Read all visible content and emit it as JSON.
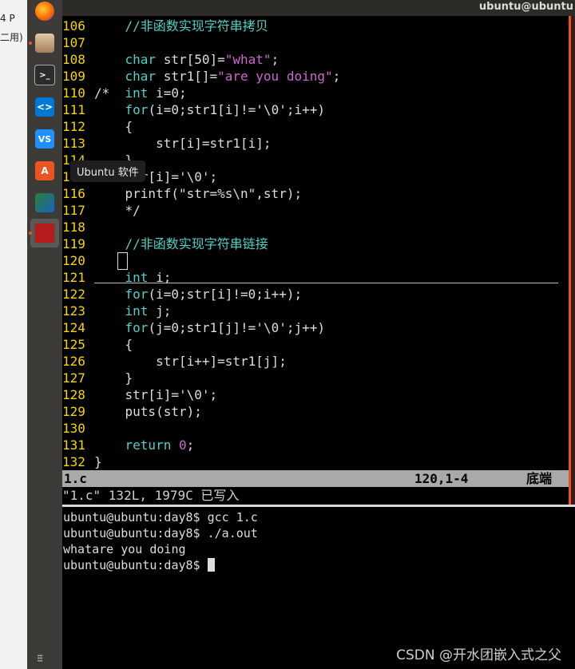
{
  "left_window": {
    "fragment1": "4 P",
    "fragment2": "二用)"
  },
  "dock": {
    "items": [
      {
        "name": "firefox-icon",
        "label": "Firefox"
      },
      {
        "name": "files-icon",
        "label": ""
      },
      {
        "name": "terminal-icon",
        "label": ""
      },
      {
        "name": "vscode-icon",
        "label": ""
      },
      {
        "name": "vscode-alt-icon",
        "label": "VS"
      },
      {
        "name": "ubuntu-software-icon",
        "label": "A"
      },
      {
        "name": "network-icon",
        "label": ""
      },
      {
        "name": "red-app-icon",
        "label": ""
      }
    ],
    "tooltip": "Ubuntu 软件",
    "apps_grid": "⁝⁝⁝"
  },
  "topbar": {
    "title": "ubuntu@ubuntu"
  },
  "vim": {
    "lines": [
      {
        "n": "106",
        "prefix": "    ",
        "html_class": "cm",
        "text": "//非函数实现字符串拷贝"
      },
      {
        "n": "107",
        "prefix": "",
        "html_class": "code",
        "text": ""
      },
      {
        "n": "108",
        "prefix": "    ",
        "segments": [
          {
            "c": "kw",
            "t": "char"
          },
          {
            "c": "code",
            "t": " str[50]="
          },
          {
            "c": "str",
            "t": "\"what\""
          },
          {
            "c": "code",
            "t": ";"
          }
        ]
      },
      {
        "n": "109",
        "prefix": "    ",
        "segments": [
          {
            "c": "kw",
            "t": "char"
          },
          {
            "c": "code",
            "t": " str1[]="
          },
          {
            "c": "str",
            "t": "\"are you doing\""
          },
          {
            "c": "code",
            "t": ";"
          }
        ]
      },
      {
        "n": "110",
        "prefix": "/*  ",
        "segments": [
          {
            "c": "kw",
            "t": "int"
          },
          {
            "c": "code",
            "t": " i=0;"
          }
        ]
      },
      {
        "n": "111",
        "prefix": "    ",
        "segments": [
          {
            "c": "kw",
            "t": "for"
          },
          {
            "c": "code",
            "t": "(i=0;str1[i]!='\\0';i++)"
          }
        ]
      },
      {
        "n": "112",
        "prefix": "    ",
        "segments": [
          {
            "c": "code",
            "t": "{"
          }
        ]
      },
      {
        "n": "113",
        "prefix": "        ",
        "segments": [
          {
            "c": "code",
            "t": "str[i]=str1[i];"
          }
        ]
      },
      {
        "n": "114",
        "prefix": "    ",
        "segments": [
          {
            "c": "code",
            "t": "}"
          }
        ]
      },
      {
        "n": "115",
        "prefix": "    ",
        "segments": [
          {
            "c": "code",
            "t": "str[i]='\\0';"
          }
        ]
      },
      {
        "n": "116",
        "prefix": "    ",
        "segments": [
          {
            "c": "code",
            "t": "printf(\"str=%s\\n\",str);"
          }
        ]
      },
      {
        "n": "117",
        "prefix": "    ",
        "segments": [
          {
            "c": "code",
            "t": "*/"
          }
        ]
      },
      {
        "n": "118",
        "prefix": "",
        "segments": []
      },
      {
        "n": "119",
        "prefix": "    ",
        "segments": [
          {
            "c": "cm",
            "t": "//非函数实现字符串链接"
          }
        ]
      },
      {
        "n": "120",
        "prefix": "",
        "segments": []
      },
      {
        "n": "121",
        "prefix": "    ",
        "segments": [
          {
            "c": "kw",
            "t": "int"
          },
          {
            "c": "code",
            "t": " i;"
          }
        ]
      },
      {
        "n": "122",
        "prefix": "    ",
        "segments": [
          {
            "c": "kw",
            "t": "for"
          },
          {
            "c": "code",
            "t": "(i=0;str[i]!=0;i++);"
          }
        ]
      },
      {
        "n": "123",
        "prefix": "    ",
        "segments": [
          {
            "c": "kw",
            "t": "int"
          },
          {
            "c": "code",
            "t": " j;"
          }
        ]
      },
      {
        "n": "124",
        "prefix": "    ",
        "segments": [
          {
            "c": "kw",
            "t": "for"
          },
          {
            "c": "code",
            "t": "(j=0;str1[j]!='\\0';j++)"
          }
        ]
      },
      {
        "n": "125",
        "prefix": "    ",
        "segments": [
          {
            "c": "code",
            "t": "{"
          }
        ]
      },
      {
        "n": "126",
        "prefix": "        ",
        "segments": [
          {
            "c": "code",
            "t": "str[i++]=str1[j];"
          }
        ]
      },
      {
        "n": "127",
        "prefix": "    ",
        "segments": [
          {
            "c": "code",
            "t": "}"
          }
        ]
      },
      {
        "n": "128",
        "prefix": "    ",
        "segments": [
          {
            "c": "code",
            "t": "str[i]='\\0';"
          }
        ]
      },
      {
        "n": "129",
        "prefix": "    ",
        "segments": [
          {
            "c": "code",
            "t": "puts(str);"
          }
        ]
      },
      {
        "n": "130",
        "prefix": "",
        "segments": []
      },
      {
        "n": "131",
        "prefix": "    ",
        "segments": [
          {
            "c": "kw",
            "t": "return"
          },
          {
            "c": "code",
            "t": " "
          },
          {
            "c": "str",
            "t": "0"
          },
          {
            "c": "code",
            "t": ";"
          }
        ]
      },
      {
        "n": "132",
        "prefix": "",
        "segments": [
          {
            "c": "code",
            "t": "}"
          }
        ]
      }
    ],
    "status": {
      "filename": "1.c",
      "position": "120,1-4",
      "scroll": "底端"
    },
    "message": "\"1.c\" 132L, 1979C 已写入"
  },
  "terminal": {
    "lines": [
      "ubuntu@ubuntu:day8$ gcc 1.c",
      "ubuntu@ubuntu:day8$ ./a.out",
      "whatare you doing",
      "ubuntu@ubuntu:day8$ "
    ]
  },
  "watermark": "CSDN @开水团嵌入式之父",
  "colors": {
    "line_number": "#f5d600",
    "keyword": "#4fd1c5",
    "string": "#cc66cc",
    "status_bg": "#a9a9a9",
    "dock_bg": "#3c3b37"
  }
}
